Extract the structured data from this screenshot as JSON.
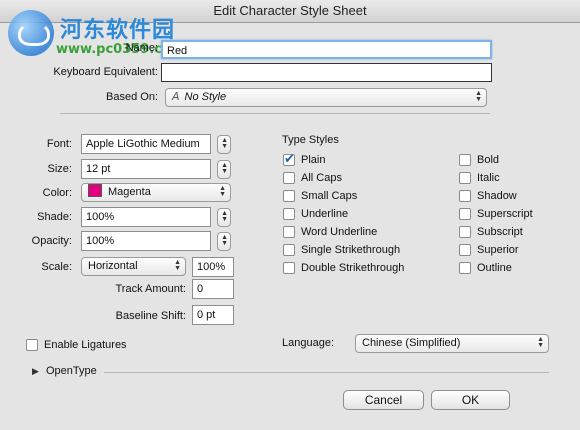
{
  "window": {
    "title": "Edit Character Style Sheet"
  },
  "watermark": {
    "name": "河东软件园",
    "url": "www.pc0359.cn"
  },
  "name": {
    "label": "Name:",
    "value": "Red"
  },
  "keyboard_equivalent": {
    "label": "Keyboard Equivalent:",
    "value": ""
  },
  "based_on": {
    "label": "Based On:",
    "icon": "character-style-icon",
    "value": "No Style"
  },
  "font": {
    "label": "Font:",
    "value": "Apple LiGothic Medium"
  },
  "size": {
    "label": "Size:",
    "value": "12 pt"
  },
  "color": {
    "label": "Color:",
    "value": "Magenta",
    "swatch": "#e4007c"
  },
  "shade": {
    "label": "Shade:",
    "value": "100%"
  },
  "opacity": {
    "label": "Opacity:",
    "value": "100%"
  },
  "scale": {
    "label": "Scale:",
    "mode": "Horizontal",
    "value": "100%"
  },
  "track_amount": {
    "label": "Track Amount:",
    "value": "0"
  },
  "baseline_shift": {
    "label": "Baseline Shift:",
    "value": "0 pt"
  },
  "type_styles": {
    "title": "Type Styles",
    "left": [
      {
        "label": "Plain",
        "checked": true
      },
      {
        "label": "All Caps",
        "checked": false
      },
      {
        "label": "Small Caps",
        "checked": false
      },
      {
        "label": "Underline",
        "checked": false
      },
      {
        "label": "Word Underline",
        "checked": false
      },
      {
        "label": "Single Strikethrough",
        "checked": false
      },
      {
        "label": "Double Strikethrough",
        "checked": false
      }
    ],
    "right": [
      {
        "label": "Bold",
        "checked": false
      },
      {
        "label": "Italic",
        "checked": false
      },
      {
        "label": "Shadow",
        "checked": false
      },
      {
        "label": "Superscript",
        "checked": false
      },
      {
        "label": "Subscript",
        "checked": false
      },
      {
        "label": "Superior",
        "checked": false
      },
      {
        "label": "Outline",
        "checked": false
      }
    ]
  },
  "ligatures": {
    "label": "Enable Ligatures",
    "checked": false
  },
  "language": {
    "label": "Language:",
    "value": "Chinese (Simplified)"
  },
  "opentype": {
    "label": "OpenType"
  },
  "buttons": {
    "cancel": "Cancel",
    "ok": "OK"
  }
}
